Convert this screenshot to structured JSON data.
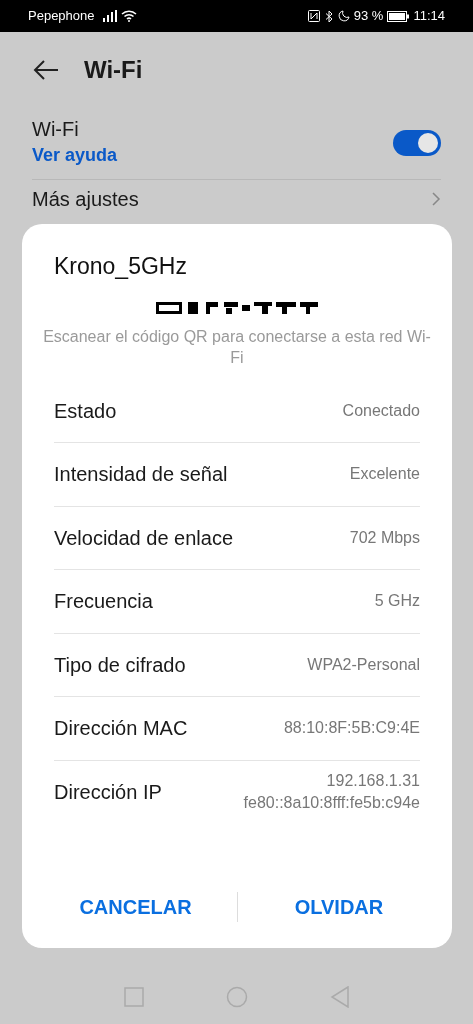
{
  "status_bar": {
    "carrier": "Pepephone",
    "battery": "93 %",
    "time": "11:14"
  },
  "header": {
    "title": "Wi-Fi"
  },
  "wifi_row": {
    "label": "Wi-Fi",
    "link": "Ver ayuda",
    "on": true
  },
  "more_row": {
    "label": "Más ajustes"
  },
  "dialog": {
    "title": "Krono_5GHz",
    "qr_hint": "Escanear el código QR para conectarse a esta red Wi-Fi",
    "rows": [
      {
        "label": "Estado",
        "value": [
          "Conectado"
        ]
      },
      {
        "label": "Intensidad de señal",
        "value": [
          "Excelente"
        ]
      },
      {
        "label": "Velocidad de enlace",
        "value": [
          "702 Mbps"
        ]
      },
      {
        "label": "Frecuencia",
        "value": [
          "5 GHz"
        ]
      },
      {
        "label": "Tipo de cifrado",
        "value": [
          "WPA2-Personal"
        ]
      },
      {
        "label": "Dirección MAC",
        "value": [
          "88:10:8F:5B:C9:4E"
        ]
      },
      {
        "label": "Dirección IP",
        "value": [
          "192.168.1.31",
          "fe80::8a10:8fff:fe5b:c94e"
        ]
      }
    ],
    "buttons": [
      "CANCELAR",
      "OLVIDAR"
    ]
  }
}
